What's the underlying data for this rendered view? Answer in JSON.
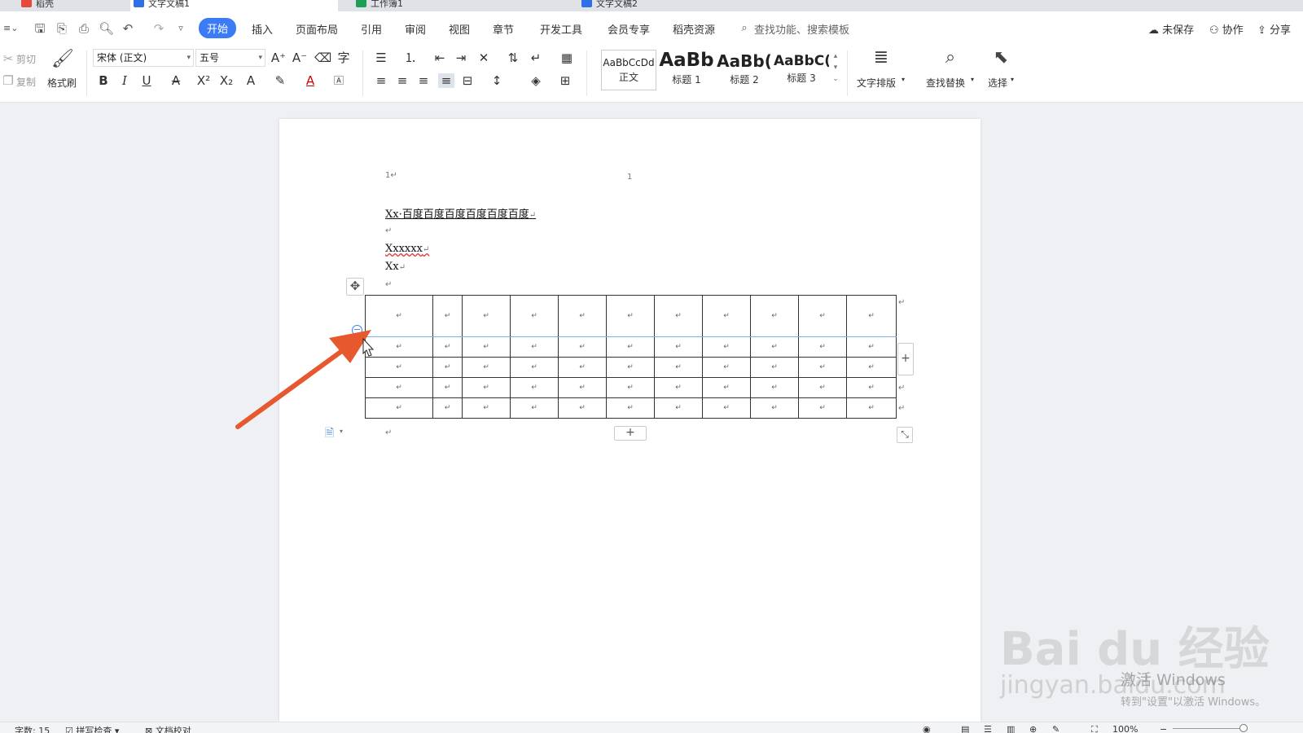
{
  "tabs": [
    {
      "label": "稻壳",
      "color": "#e8473b"
    },
    {
      "label": "文字文稿1",
      "color": "#2f6fe8",
      "active": true
    },
    {
      "label": "工作簿1",
      "color": "#1f9e57"
    },
    {
      "label": "文字文稿2",
      "color": "#2f6fe8"
    }
  ],
  "menu": {
    "items": [
      "开始",
      "插入",
      "页面布局",
      "引用",
      "审阅",
      "视图",
      "章节",
      "开发工具",
      "会员专享",
      "稻壳资源"
    ],
    "active_index": 0,
    "search_placeholder": "查找功能、搜索模板",
    "unsaved": "未保存",
    "collab": "协作",
    "share": "分享"
  },
  "ribbon": {
    "cut": "剪切",
    "copy": "复制",
    "format_painter": "格式刷",
    "font_name": "宋体 (正文)",
    "font_size": "五号",
    "styles": [
      {
        "preview": "AaBbCcDd",
        "label": "正文"
      },
      {
        "preview": "AaBb",
        "label": "标题 1"
      },
      {
        "preview": "AaBb(",
        "label": "标题 2"
      },
      {
        "preview": "AaBbC(",
        "label": "标题 3"
      }
    ],
    "text_layout": "文字排版",
    "find_replace": "查找替换",
    "select": "选择"
  },
  "document": {
    "header_left": "1↵",
    "header_num": "1",
    "title_line": "Xx·百度百度百度百度百度百度",
    "line_xxxxxx": "Xxxxxx",
    "line_xx": "Xx",
    "para_mark": "↵",
    "cell_mark": "↵",
    "table": {
      "rows": 5,
      "cols": 11
    },
    "add_symbol": "+"
  },
  "status": {
    "word_count": "字数: 15",
    "spell_check": "拼写检查",
    "doc_check": "文档校对",
    "zoom": "100%"
  },
  "watermark": {
    "brand": "Bai  du 经验",
    "url": "jingyan.baidu.com",
    "activate1": "激活 Windows",
    "activate2": "转到\"设置\"以激活 Windows。"
  },
  "colors": {
    "accent": "#3b7bf5",
    "arrow": "#e8582e",
    "selection": "#7fb3e8"
  }
}
